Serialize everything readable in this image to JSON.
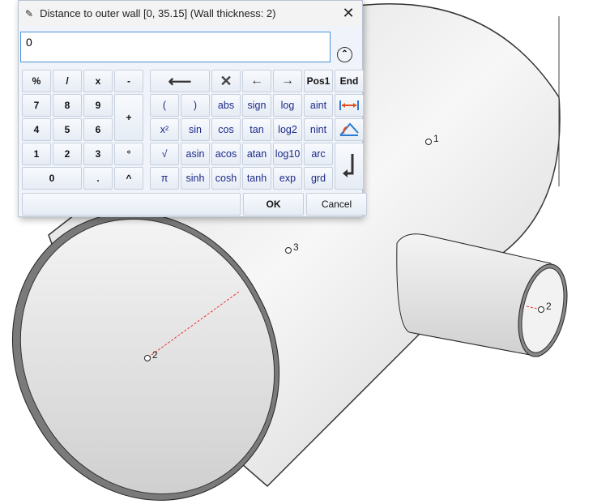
{
  "dialog": {
    "title": "Distance to outer wall [0, 35.15] (Wall thickness: 2)",
    "input_value": "0",
    "ok": "OK",
    "cancel": "Cancel",
    "close": "✕",
    "collapse": "⌃"
  },
  "numpad": [
    "%",
    "/",
    "x",
    "-",
    "7",
    "8",
    "9",
    "+",
    "4",
    "5",
    "6",
    "1",
    "2",
    "3",
    "°",
    "0",
    ".",
    "^"
  ],
  "functions": {
    "row0": [
      "⟵",
      "✕",
      "←",
      "→",
      "Pos1",
      "End"
    ],
    "row1": [
      "(",
      ")",
      "abs",
      "sign",
      "log",
      "aint"
    ],
    "row2": [
      "x²",
      "sin",
      "cos",
      "tan",
      "log2",
      "nint"
    ],
    "row3": [
      "√",
      "asin",
      "acos",
      "atan",
      "log10",
      "arc"
    ],
    "row4": [
      "π",
      "sinh",
      "cosh",
      "tanh",
      "exp",
      "grd"
    ]
  },
  "scene": {
    "points": [
      "1",
      "3",
      "2",
      "2"
    ]
  }
}
